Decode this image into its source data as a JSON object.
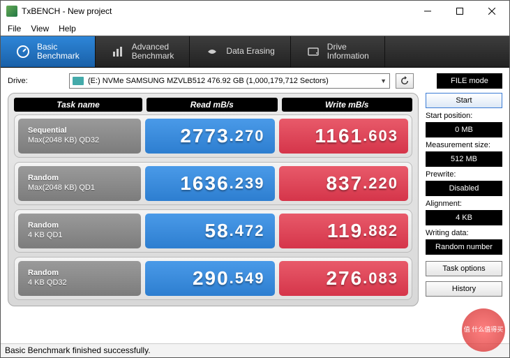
{
  "window": {
    "title": "TxBENCH - New project"
  },
  "menu": {
    "file": "File",
    "view": "View",
    "help": "Help"
  },
  "tabs": [
    {
      "line1": "Basic",
      "line2": "Benchmark",
      "active": true
    },
    {
      "line1": "Advanced",
      "line2": "Benchmark",
      "active": false
    },
    {
      "line1": "Data Erasing",
      "line2": "",
      "active": false
    },
    {
      "line1": "Drive",
      "line2": "Information",
      "active": false
    }
  ],
  "drive": {
    "label": "Drive:",
    "selected": "(E:) NVMe SAMSUNG MZVLB512  476.92 GB (1,000,179,712 Sectors)"
  },
  "filemode": "FILE mode",
  "headers": {
    "task": "Task name",
    "read": "Read mB/s",
    "write": "Write mB/s"
  },
  "rows": [
    {
      "name1": "Sequential",
      "name2": "Max(2048 KB) QD32",
      "read_i": "2773",
      "read_d": "270",
      "write_i": "1161",
      "write_d": "603"
    },
    {
      "name1": "Random",
      "name2": "Max(2048 KB) QD1",
      "read_i": "1636",
      "read_d": "239",
      "write_i": "837",
      "write_d": "220"
    },
    {
      "name1": "Random",
      "name2": "4 KB QD1",
      "read_i": "58",
      "read_d": "472",
      "write_i": "119",
      "write_d": "882"
    },
    {
      "name1": "Random",
      "name2": "4 KB QD32",
      "read_i": "290",
      "read_d": "549",
      "write_i": "276",
      "write_d": "083"
    }
  ],
  "side": {
    "start": "Start",
    "start_pos_label": "Start position:",
    "start_pos_value": "0 MB",
    "meas_label": "Measurement size:",
    "meas_value": "512 MB",
    "prewrite_label": "Prewrite:",
    "prewrite_value": "Disabled",
    "align_label": "Alignment:",
    "align_value": "4 KB",
    "wdata_label": "Writing data:",
    "wdata_value": "Random number",
    "task_options": "Task options",
    "history": "History"
  },
  "status": "Basic Benchmark finished successfully.",
  "watermark": "值 什么值得买"
}
